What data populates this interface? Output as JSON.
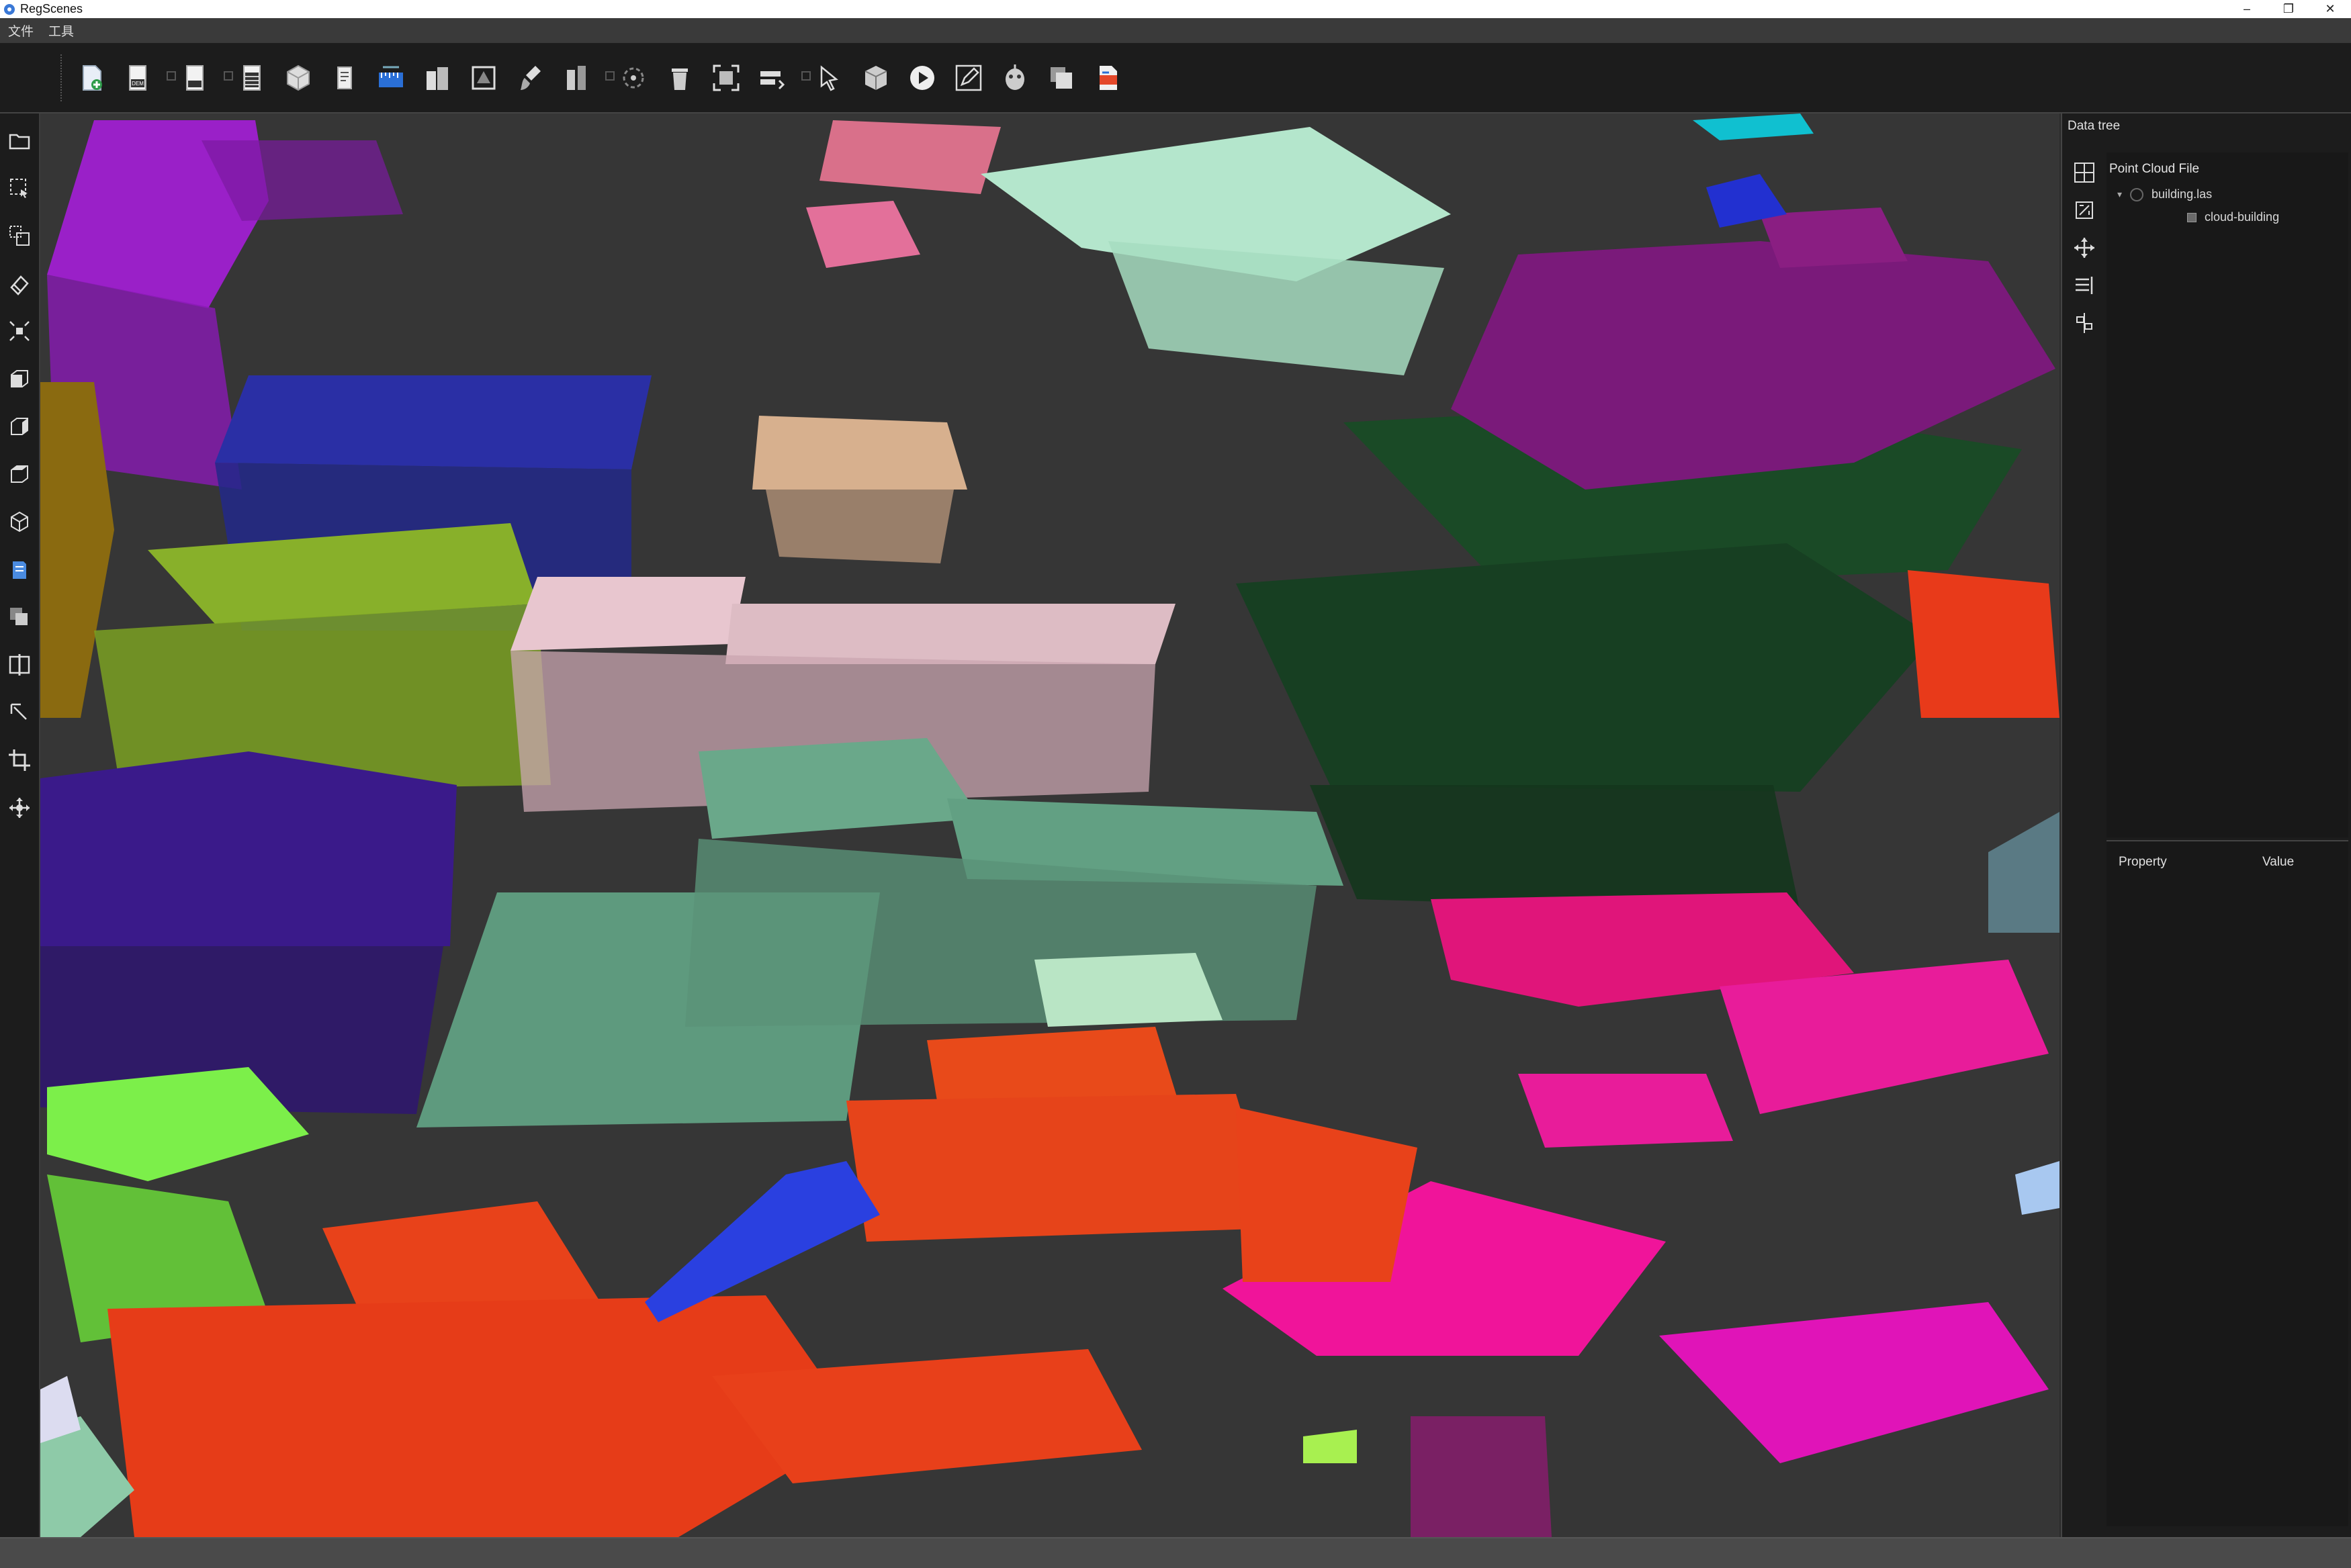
{
  "window": {
    "title": "RegScenes",
    "controls": {
      "minimize": "–",
      "restore": "❐",
      "close": "✕"
    }
  },
  "menubar": {
    "items": [
      {
        "label": "文件"
      },
      {
        "label": "工具"
      }
    ]
  },
  "toolbar": {
    "icons": [
      "new-file-icon",
      "dem-export-icon",
      "export-icon",
      "export-table-icon",
      "mesh-icon",
      "document-icon",
      "measure-icon",
      "buildings-icon",
      "polygon-crop-icon",
      "brush-icon",
      "split-icon",
      "segment-icon",
      "delete-icon",
      "fit-view-icon",
      "cloud-edit-icon",
      "pointer-icon",
      "cube-icon",
      "play-icon",
      "pen-edit-icon",
      "robot-icon",
      "layers-icon",
      "report-icon"
    ],
    "dem_badge": "DEM"
  },
  "left_toolbar": {
    "icons": [
      "open-folder-icon",
      "select-points-icon",
      "merge-clouds-icon",
      "eraser-icon",
      "center-points-icon",
      "front-view-icon",
      "side-view-icon",
      "top-view-icon",
      "3d-view-icon",
      "color-icon",
      "layers-icon",
      "split-view-icon",
      "select-arrow-icon",
      "crop-icon",
      "move-icon"
    ]
  },
  "right_panel": {
    "title": "Data tree",
    "tree": {
      "root_label": "Point Cloud File",
      "file_label": "building.las",
      "cloud_label": "cloud-building"
    },
    "properties": {
      "col_property": "Property",
      "col_value": "Value"
    }
  },
  "colors": {
    "accent": "#3a78d6",
    "viewport_bg": "#363636",
    "panel_bg": "#1c1c1c"
  }
}
